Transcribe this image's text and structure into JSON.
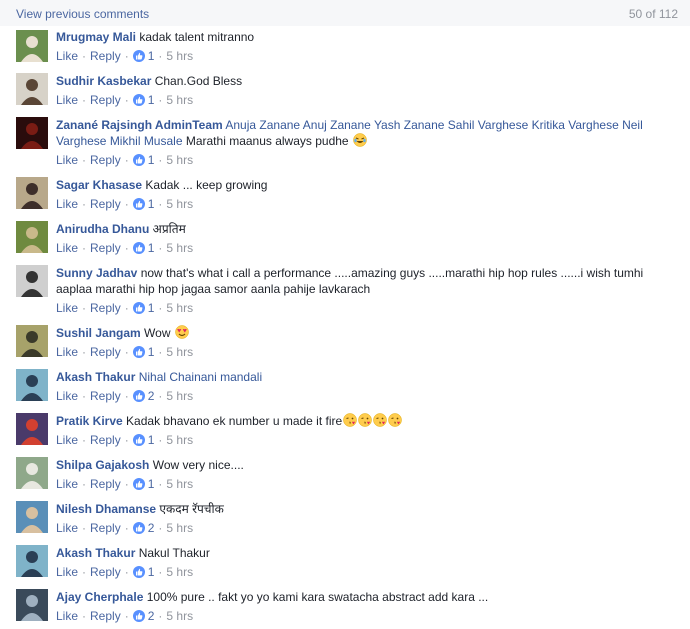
{
  "header": {
    "view_previous": "View previous comments",
    "count": "50 of 112"
  },
  "actions": {
    "like": "Like",
    "reply": "Reply",
    "sep": "·"
  },
  "comments": [
    {
      "author": "Mrugmay Mali",
      "text": "kadak talent mitranno",
      "likes": "1",
      "time": "5 hrs",
      "avatar": {
        "bg": "#6b8f4e",
        "fg": "#e8e0d0"
      }
    },
    {
      "author": "Sudhir Kasbekar",
      "text": "Chan.God Bless",
      "likes": "1",
      "time": "5 hrs",
      "avatar": {
        "bg": "#d7d2c8",
        "fg": "#5a4636"
      }
    },
    {
      "author": "Zanané Rajsingh AdminTeam",
      "tags": "Anuja Zanane Anuj Zanane Yash Zanane Sahil Varghese Kritika Varghese Neil Varghese Mikhil Musale",
      "text": "Marathi maanus always pudhe",
      "emoji": "laugh",
      "likes": "1",
      "time": "5 hrs",
      "avatar": {
        "bg": "#2a0c0c",
        "fg": "#7a1c14"
      }
    },
    {
      "author": "Sagar Khasase",
      "text": "Kadak ... keep growing",
      "likes": "1",
      "time": "5 hrs",
      "avatar": {
        "bg": "#b8a88a",
        "fg": "#3d2e2a"
      }
    },
    {
      "author": "Anirudha Dhanu",
      "text": "अप्रतिम",
      "likes": "1",
      "time": "5 hrs",
      "avatar": {
        "bg": "#6f8a3f",
        "fg": "#c9b98a"
      }
    },
    {
      "author": "Sunny Jadhav",
      "text": "now that's what i call a performance .....amazing guys .....marathi hip hop rules ......i wish tumhi aaplaa marathi hip hop jagaa samor aanla pahije lavkarach",
      "likes": "1",
      "time": "5 hrs",
      "avatar": {
        "bg": "#cfcfcf",
        "fg": "#333333"
      }
    },
    {
      "author": "Sushil Jangam",
      "text": "Wow",
      "emoji": "heart-eyes",
      "likes": "1",
      "time": "5 hrs",
      "avatar": {
        "bg": "#a7a26a",
        "fg": "#3a3a2a"
      }
    },
    {
      "author": "Akash Thakur",
      "text": "Nihal Chainani mandali",
      "tag_text": true,
      "likes": "2",
      "time": "5 hrs",
      "avatar": {
        "bg": "#7fb3c9",
        "fg": "#2a3f55"
      }
    },
    {
      "author": "Pratik Kirve",
      "text": "Kadak bhavano ek number u made it fire",
      "emoji4": "kiss",
      "likes": "1",
      "time": "5 hrs",
      "avatar": {
        "bg": "#4a3a6a",
        "fg": "#d24030"
      }
    },
    {
      "author": "Shilpa Gajakosh",
      "text": "Wow very nice....",
      "likes": "1",
      "time": "5 hrs",
      "avatar": {
        "bg": "#8fa88a",
        "fg": "#e8e8e0"
      }
    },
    {
      "author": "Nilesh Dhamanse",
      "text": "एकदम रॅपचीक",
      "likes": "2",
      "time": "5 hrs",
      "avatar": {
        "bg": "#5a8fb8",
        "fg": "#d8c0a0"
      }
    },
    {
      "author": "Akash Thakur",
      "text": "Nakul Thakur",
      "likes": "1",
      "time": "5 hrs",
      "avatar": {
        "bg": "#7fb3c9",
        "fg": "#2a3f55"
      }
    },
    {
      "author": "Ajay Cherphale",
      "text": "100% pure .. fakt yo yo kami kara swatacha abstract add kara ...",
      "likes": "2",
      "time": "5 hrs",
      "avatar": {
        "bg": "#3a4a5a",
        "fg": "#9fb0c0"
      }
    }
  ]
}
